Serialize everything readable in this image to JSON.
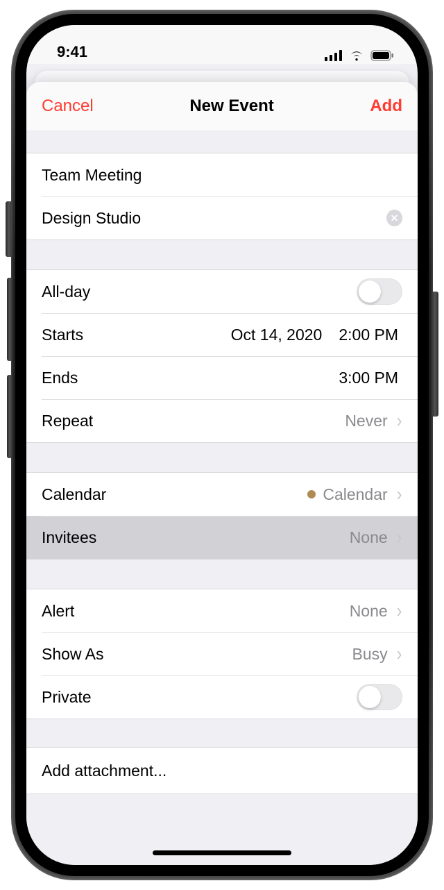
{
  "status": {
    "time": "9:41"
  },
  "nav": {
    "cancel": "Cancel",
    "title": "New Event",
    "add": "Add"
  },
  "event": {
    "title": "Team Meeting",
    "location": "Design Studio"
  },
  "labels": {
    "allday": "All-day",
    "starts": "Starts",
    "ends": "Ends",
    "repeat": "Repeat",
    "calendar": "Calendar",
    "invitees": "Invitees",
    "alert": "Alert",
    "showas": "Show As",
    "private": "Private",
    "attach": "Add attachment..."
  },
  "values": {
    "starts_date": "Oct 14, 2020",
    "starts_time": "2:00 PM",
    "ends_time": "3:00 PM",
    "repeat": "Never",
    "calendar": "Calendar",
    "invitees": "None",
    "alert": "None",
    "showas": "Busy"
  }
}
